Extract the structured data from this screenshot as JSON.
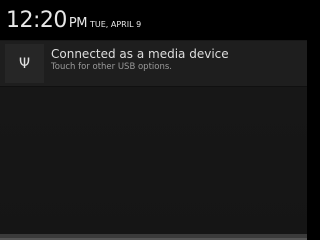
{
  "status_bar": {
    "time": "12:20",
    "ampm": "PM",
    "date": "TUE, APRIL 9"
  },
  "notification": {
    "icon": "usb-icon",
    "title": "Connected as a media device",
    "subtitle": "Touch for other USB options."
  }
}
